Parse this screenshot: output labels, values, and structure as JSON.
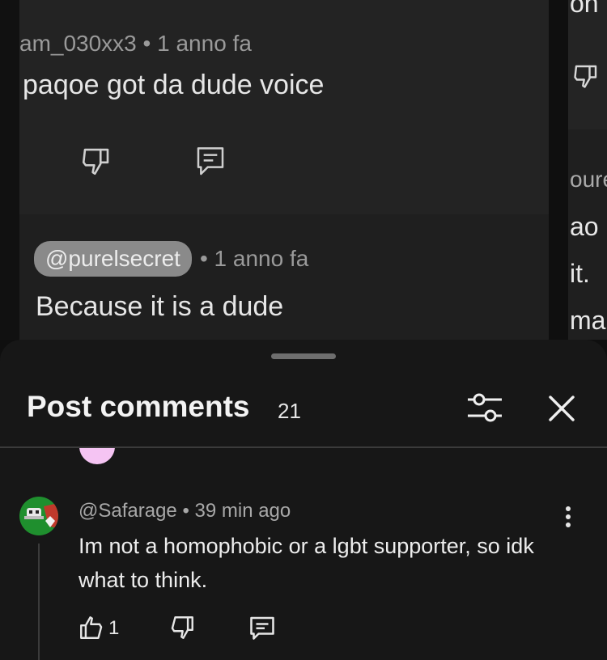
{
  "background": {
    "comment": {
      "meta": "am_030xx3 • 1 anno fa",
      "text": "paqoe got da dude voice"
    },
    "reply": {
      "mention": "@purelsecret",
      "meta": "• 1 anno fa",
      "text": "Because it is a dude"
    },
    "right_fragments": [
      "on",
      "oure",
      "ao",
      "it.",
      "ma"
    ]
  },
  "sheet": {
    "title": "Post comments",
    "count": "21"
  },
  "comment": {
    "author": "@Safarage",
    "time": "39 min ago",
    "meta": "@Safarage • 39 min ago",
    "text": "Im not a homophobic or a lgbt supporter, so idk what to think.",
    "likes": "1"
  },
  "colors": {
    "sheet_bg": "#171717",
    "page_bg": "#0f0f0f",
    "text_primary": "#ededed",
    "text_secondary": "#a8a8a8",
    "avatar_green": "#1f8f2e",
    "avatar_red": "#c0392b",
    "peek_avatar": "#f5c4f3"
  },
  "icons": {
    "filter": "sliders-icon",
    "close": "close-icon",
    "more": "more-vertical-icon",
    "like": "thumbs-up-icon",
    "dislike": "thumbs-down-icon",
    "reply": "comment-icon"
  }
}
